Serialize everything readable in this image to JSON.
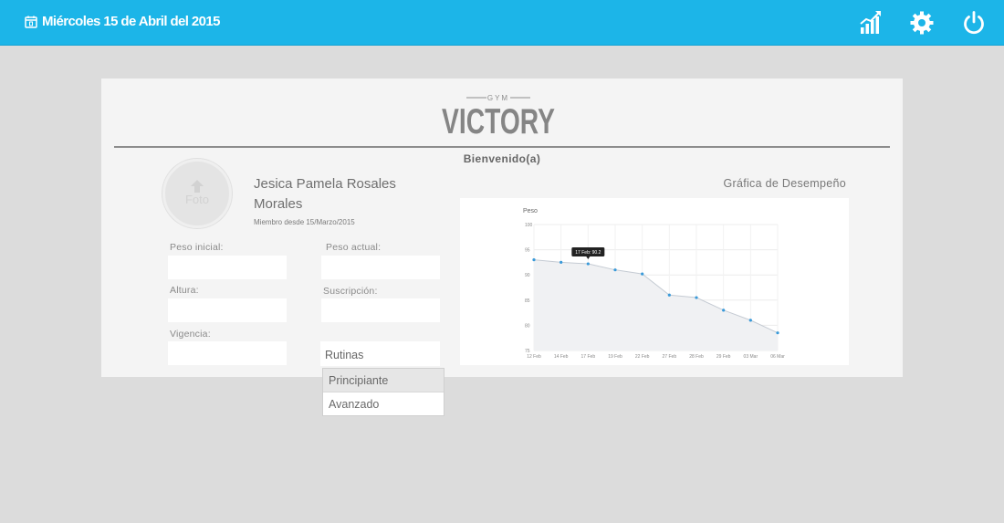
{
  "header": {
    "date": "Miércoles 15 de Abril del 2015",
    "calendar_icon": "calendar-icon",
    "icons": [
      "stats-icon",
      "gear-icon",
      "power-icon"
    ]
  },
  "brand": {
    "subtitle": "GYM",
    "name": "VICTORY"
  },
  "welcome": "Bienvenido(a)",
  "profile": {
    "photo_label": "Foto",
    "photo_icon": "upload-arrow-icon",
    "name": "Jesica Pamela Rosales Morales",
    "member_since": "Miembro desde 15/Marzo/2015"
  },
  "form": {
    "peso_inicial": {
      "label": "Peso inicial:",
      "value": ""
    },
    "peso_actual": {
      "label": "Peso actual:",
      "value": ""
    },
    "altura": {
      "label": "Altura:",
      "value": ""
    },
    "suscripcion": {
      "label": "Suscripción:",
      "value": ""
    },
    "vigencia": {
      "label": "Vigencia:",
      "value": ""
    },
    "rutinas": {
      "label": "Rutinas",
      "options": [
        "Principiante",
        "Avanzado"
      ],
      "highlighted": "Principiante"
    }
  },
  "chart_title": "Gráfica de Desempeño",
  "chart_data": {
    "type": "line",
    "ylabel": "Peso",
    "ylim": [
      75,
      100
    ],
    "yticks": [
      75,
      80,
      85,
      90,
      95,
      100
    ],
    "categories": [
      "12 Feb",
      "14 Feb",
      "17 Feb",
      "19 Feb",
      "22 Feb",
      "27 Feb",
      "28 Feb",
      "29 Feb",
      "03 Mar",
      "06 Mar"
    ],
    "values": [
      93,
      92.5,
      92.2,
      91,
      90.2,
      86,
      85.5,
      83,
      81,
      78.5
    ],
    "grid": true,
    "tooltip": "17 Feb: 90.2",
    "colors": {
      "line": "#c5cbd3",
      "fill": "#f0f1f3",
      "point": "#3a9ad9"
    }
  },
  "colors": {
    "topbar": "#1cb5e8",
    "background": "#dcdcdc",
    "card": "#f4f4f4"
  }
}
